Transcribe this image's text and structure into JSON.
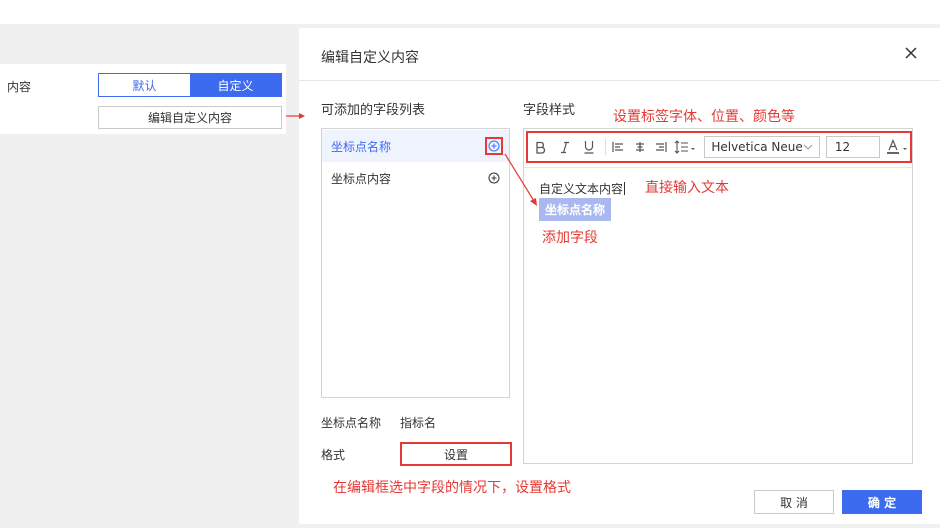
{
  "left_panel": {
    "label": "内容",
    "toggle_default": "默认",
    "toggle_custom": "自定义",
    "edit_button": "编辑自定义内容"
  },
  "dialog": {
    "title": "编辑自定义内容",
    "field_list_title": "可添加的字段列表",
    "style_title": "字段样式",
    "fields": [
      {
        "label": "坐标点名称"
      },
      {
        "label": "坐标点内容"
      }
    ],
    "toolbar": {
      "font": "Helvetica Neue",
      "size": "12"
    },
    "editor_text": "自定义文本内容",
    "inserted_field": "坐标点名称",
    "props": {
      "field_label": "坐标点名称",
      "field_value": "指标名",
      "format_label": "格式",
      "settings_button": "设置"
    },
    "cancel": "取 消",
    "ok": "确 定"
  },
  "annotations": {
    "toolbar_note": "设置标签字体、位置、颜色等",
    "type_note": "直接输入文本",
    "add_note": "添加字段",
    "format_note": "在编辑框选中字段的情况下，设置格式"
  },
  "colors": {
    "accent": "#3d6bef",
    "annotation": "#e53935",
    "chip": "#a9b9f0"
  }
}
